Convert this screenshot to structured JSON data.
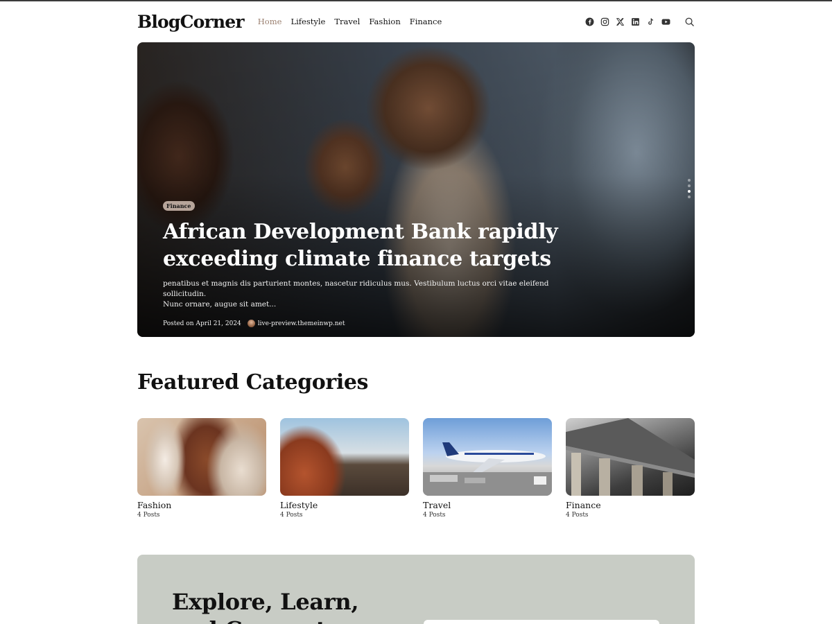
{
  "header": {
    "logo": "BlogCorner",
    "nav": [
      "Home",
      "Lifestyle",
      "Travel",
      "Fashion",
      "Finance"
    ],
    "active_nav": "Home",
    "social_icons": [
      "facebook-icon",
      "instagram-icon",
      "x-icon",
      "linkedin-icon",
      "tiktok-icon",
      "youtube-icon"
    ],
    "search_icon": "search-icon"
  },
  "hero": {
    "category": "Finance",
    "title_line1": "African Development Bank rapidly",
    "title_line2": "exceeding climate finance targets",
    "excerpt_line1": "penatibus et magnis dis parturient montes, nascetur ridiculus mus. Vestibulum luctus orci vitae eleifend sollicitudin.",
    "excerpt_line2": "Nunc ornare, augue sit amet...",
    "posted_label": "Posted on",
    "date": "April 21, 2024",
    "author": "live-preview.themeinwp.net",
    "slide_dots": 4,
    "active_slide": 3
  },
  "featured": {
    "title": "Featured Categories",
    "categories": [
      {
        "name": "Fashion",
        "count": "4 Posts"
      },
      {
        "name": "Lifestyle",
        "count": "4 Posts"
      },
      {
        "name": "Travel",
        "count": "4 Posts"
      },
      {
        "name": "Finance",
        "count": "4 Posts"
      }
    ]
  },
  "explore": {
    "title_line1": "Explore, Learn,",
    "title_line2": "and Connect"
  },
  "colors": {
    "accent_nav": "#9a7f6f",
    "badge": "#b7a59a",
    "explore_bg": "#c8ccc5"
  }
}
